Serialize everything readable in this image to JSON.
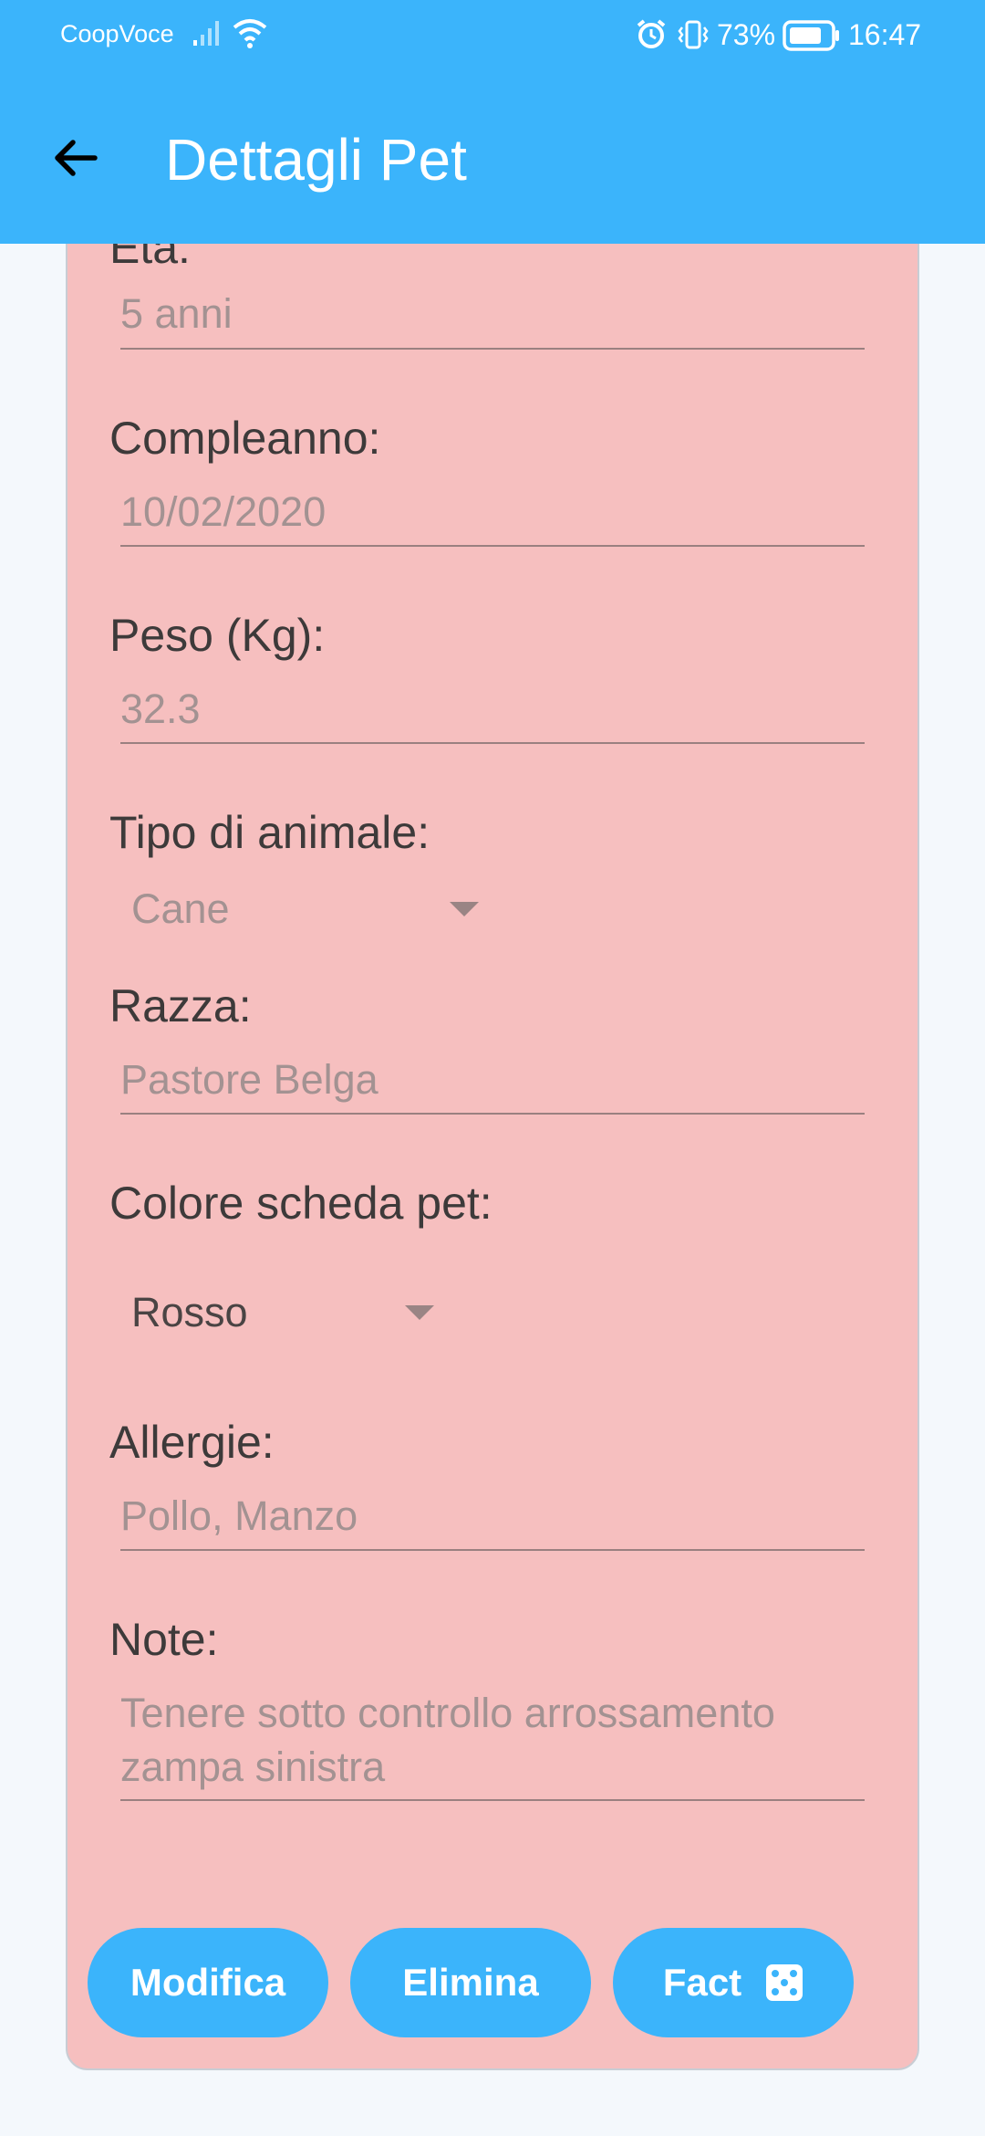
{
  "status_bar": {
    "carrier": "CoopVoce",
    "battery_percent": "73%",
    "time": "16:47",
    "icons": [
      "signal-icon",
      "wifi-icon",
      "alarm-icon",
      "vibrate-icon",
      "battery-icon"
    ]
  },
  "app_bar": {
    "title": "Dettagli Pet",
    "back_icon": "arrow-back-icon"
  },
  "colors": {
    "app_bar": "#3bb4fb",
    "card_background": "#f6bfbf",
    "button": "#3bb4fb",
    "page_background": "#f4f8fc"
  },
  "form": {
    "eta": {
      "label": "Età:",
      "value": "5 anni"
    },
    "compleanno": {
      "label": "Compleanno:",
      "value": "10/02/2020"
    },
    "peso": {
      "label": "Peso (Kg):",
      "value": "32.3"
    },
    "tipo_animale": {
      "label": "Tipo di animale:",
      "selected": "Cane"
    },
    "razza": {
      "label": "Razza:",
      "value": "Pastore Belga"
    },
    "colore_scheda": {
      "label": "Colore scheda pet:",
      "selected": "Rosso"
    },
    "allergie": {
      "label": "Allergie:",
      "value": "Pollo, Manzo"
    },
    "note": {
      "label": "Note:",
      "line1": "Tenere sotto controllo arrossamento",
      "line2": "zampa sinistra"
    }
  },
  "buttons": {
    "modifica": "Modifica",
    "elimina": "Elimina",
    "fact": "Fact",
    "fact_icon": "dice-icon"
  }
}
